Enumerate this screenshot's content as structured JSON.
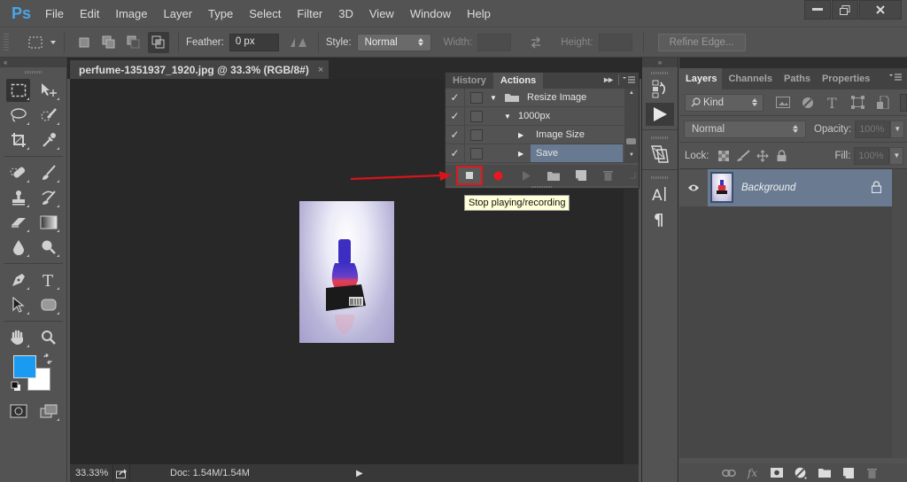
{
  "app": {
    "logo": "Ps",
    "menu": [
      "File",
      "Edit",
      "Image",
      "Layer",
      "Type",
      "Select",
      "Filter",
      "3D",
      "View",
      "Window",
      "Help"
    ],
    "window_controls": {
      "minimize": "minimize-icon",
      "restore": "restore-icon",
      "close": "close-icon"
    }
  },
  "options_bar": {
    "tool": "rectangular-marquee",
    "selection_modes": [
      "new-selection",
      "add-to-selection",
      "subtract-from-selection",
      "intersect-with-selection"
    ],
    "active_mode": "intersect-with-selection",
    "feather_label": "Feather:",
    "feather_value": "0 px",
    "style_label": "Style:",
    "style_value": "Normal",
    "width_label": "Width:",
    "width_value": "",
    "height_label": "Height:",
    "height_value": "",
    "refine_edge_label": "Refine Edge..."
  },
  "toolbox": {
    "collapse_icon": "«",
    "tools": [
      [
        "rectangular-marquee",
        "move"
      ],
      [
        "lasso",
        "quick-selection"
      ],
      [
        "crop",
        "eyedropper"
      ],
      [
        "spot-healing-brush",
        "brush"
      ],
      [
        "clone-stamp",
        "history-brush"
      ],
      [
        "eraser",
        "gradient"
      ],
      [
        "blur",
        "dodge"
      ],
      [
        "pen",
        "horizontal-type"
      ],
      [
        "path-selection",
        "rounded-rectangle"
      ],
      [
        "hand",
        "zoom"
      ]
    ],
    "foreground_color": "#1a9af0",
    "background_color": "#ffffff"
  },
  "document": {
    "tab_title": "perfume-1351937_1920.jpg @ 33.3% (RGB/8#)",
    "close": "×",
    "zoom": "33.33%",
    "doc_size": "Doc: 1.54M/1.54M"
  },
  "actions_panel": {
    "tabs": [
      "History",
      "Actions"
    ],
    "active_tab": "Actions",
    "rows": [
      {
        "checked": true,
        "indent": 0,
        "expanded": true,
        "folder": true,
        "label": "Resize Image",
        "selected": false
      },
      {
        "checked": true,
        "indent": 1,
        "expanded": true,
        "folder": false,
        "label": "1000px",
        "selected": false
      },
      {
        "checked": true,
        "indent": 2,
        "expanded": false,
        "folder": false,
        "label": "Image Size",
        "selected": false
      },
      {
        "checked": true,
        "indent": 2,
        "expanded": false,
        "folder": false,
        "label": "Save",
        "selected": true
      }
    ],
    "bottom_buttons": [
      "stop-playing-recording",
      "begin-recording",
      "play-selection",
      "create-new-set",
      "create-new-action",
      "delete"
    ],
    "tooltip": "Stop playing/recording",
    "highlight_color": "#e0161b"
  },
  "dock": {
    "collapse_icon": "»",
    "buttons": [
      "history",
      "actions",
      "clone-source",
      "character",
      "paragraph"
    ],
    "active": "actions"
  },
  "layers_panel": {
    "tabs": [
      "Layers",
      "Channels",
      "Paths",
      "Properties"
    ],
    "active_tab": "Layers",
    "filter_kind": "Kind",
    "blend_mode": "Normal",
    "opacity_label": "Opacity:",
    "opacity_value": "100%",
    "lock_label": "Lock:",
    "fill_label": "Fill:",
    "fill_value": "100%",
    "layers": [
      {
        "name": "Background",
        "visible": true,
        "locked": true,
        "selected": true
      }
    ],
    "bottom_buttons": [
      "link-layers",
      "add-layer-style",
      "add-mask",
      "new-adjustment-layer",
      "new-group",
      "new-layer",
      "delete-layer"
    ],
    "fx_label": "fx"
  }
}
